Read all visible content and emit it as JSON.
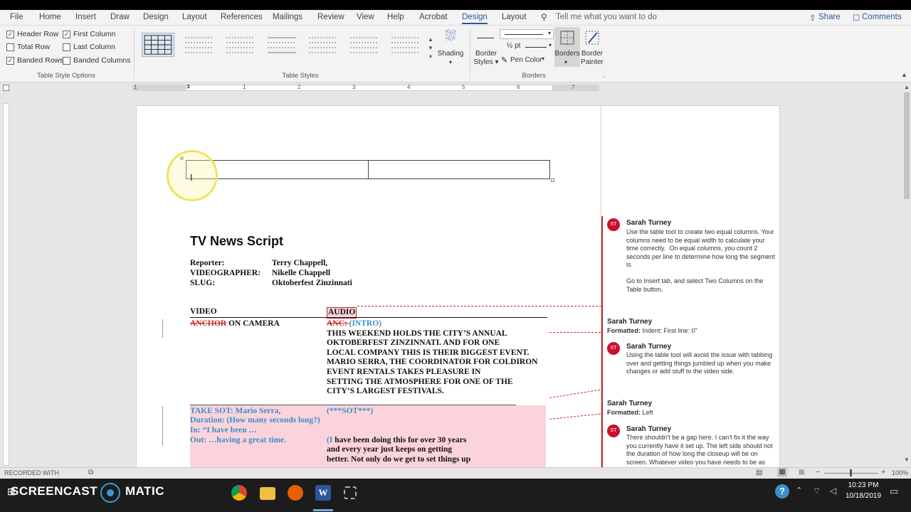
{
  "menu": {
    "items": [
      "File",
      "Home",
      "Insert",
      "Draw",
      "Design",
      "Layout",
      "References",
      "Mailings",
      "Review",
      "View",
      "Help",
      "Acrobat",
      "Design",
      "Layout"
    ],
    "active_index": 12,
    "tell_me": "Tell me what you want to do",
    "share": "Share",
    "comments": "Comments"
  },
  "ribbon": {
    "options": {
      "header_row": "Header Row",
      "first_column": "First Column",
      "total_row": "Total Row",
      "last_column": "Last Column",
      "banded_rows": "Banded Rows",
      "banded_columns": "Banded Columns",
      "group_label": "Table Style Options"
    },
    "styles_label": "Table Styles",
    "shading": "Shading",
    "border_styles_1": "Border",
    "border_styles_2": "Styles",
    "pen_weight": "½ pt",
    "pen_color": "Pen Color",
    "borders": "Borders",
    "border_painter_1": "Border",
    "border_painter_2": "Painter",
    "borders_group_label": "Borders"
  },
  "ruler": {
    "numbers": [
      "1",
      "1",
      "2",
      "3",
      "4",
      "5",
      "6",
      "7"
    ]
  },
  "doc": {
    "title": "TV News Script",
    "labels": [
      {
        "k": "Reporter:",
        "v": "Terry Chappell,"
      },
      {
        "k": "VIDEOGRAPHER:",
        "v": "Nikelle Chappell"
      },
      {
        "k": "SLUG:",
        "v": "Oktoberfest Zinzinnati"
      }
    ],
    "video_header": "VIDEO",
    "audio_header": "AUDIO",
    "anchor_struck": "ANCHOR",
    "on_camera": " ON CAMERA",
    "anc_struck": "ANC: ",
    "intro": "(INTRO)",
    "audio_lines": [
      "THIS WEEKEND HOLDS THE CITY’S ANNUAL",
      "OKTOBERFEST ZINZINNATI. AND FOR ONE",
      "LOCAL COMPANY THIS IS THEIR BIGGEST EVENT.",
      "MARIO SERRA, THE COORDINATOR FOR COLDIRON",
      "EVENT RENTALS TAKES PLEASURE IN",
      "SETTING THE ATMOSPHERE FOR ONE OF THE",
      "CITY’S LARGEST FESTIVALS."
    ],
    "sot_lines": [
      "TAKE SOT: Mario Serra,",
      "Duration: (How many seconds long?)",
      "In: “I have been …",
      "Out: …having a great time."
    ],
    "sot_audio": "(***SOT***)",
    "quote_open": "(I",
    "quote_lines": [
      " have been doing this for over 30 years",
      "and every year just keeps on getting",
      "better. Not only do we get to set things up"
    ]
  },
  "comments": [
    {
      "author": "Sarah Turney",
      "initials": "ST",
      "text": "Use the table tool to create two equal columns. Your columns need to be equal width to calculate your time correctly.  On equal columns, you count 2 seconds per line to determine how long the segment is.\n\nGo to Insert tab, and select Two Columns on the Table button."
    },
    {
      "author": "Sarah Turney",
      "formatted": "Formatted:",
      "value": "Indent: First line:  0\""
    },
    {
      "author": "Sarah Turney",
      "initials": "ST",
      "text": "Using the table tool will avoid the issue with tabbing over and getting things jumbled up when you make changes or add stuff to the video side."
    },
    {
      "author": "Sarah Turney",
      "formatted": "Formatted:",
      "value": "Left"
    },
    {
      "author": "Sarah Turney",
      "initials": "ST",
      "text": "There shouldn't be a gap here. I can't fix it the way you currently have it set up. The left side should not the duration of how long the closeup will be on screen. Whatever video you have needs to be as long"
    }
  ],
  "status": {
    "zoom": "100%"
  },
  "watermark": {
    "recorded": "RECORDED WITH",
    "brand_left": "SCREENCAST",
    "brand_right": "MATIC"
  },
  "taskbar": {
    "time": "10:23 PM",
    "date": "10/18/2019"
  },
  "colors": {
    "accent": "#2b579a",
    "comment": "#c8102e",
    "sot_blue": "#3b8fc6",
    "pink": "#fbd3dc"
  }
}
